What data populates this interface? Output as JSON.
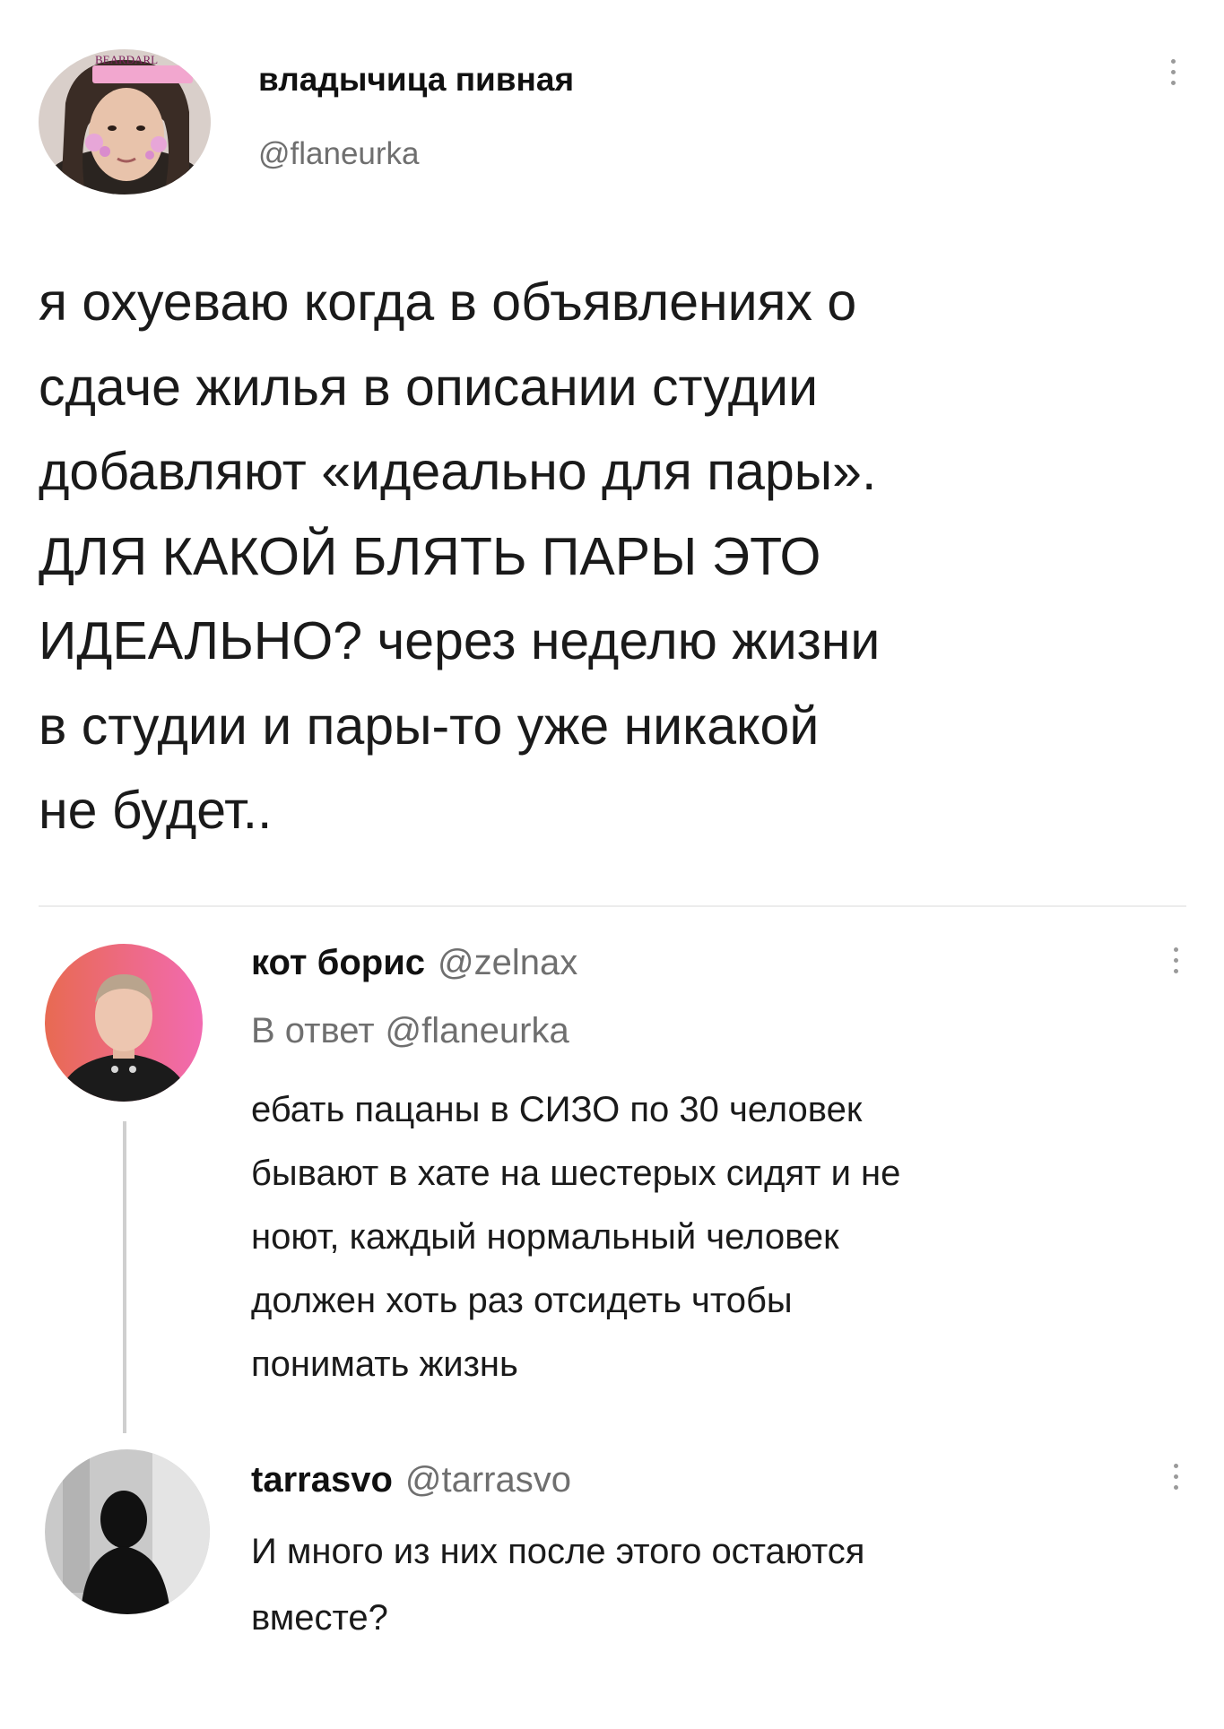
{
  "main_tweet": {
    "author_name": "владычица пивная",
    "author_handle": "@flaneurka",
    "avatar_badge_text": "BEARDARL",
    "text_lines": [
      "я охуеваю когда в объявлениях о",
      "сдаче жилья в описании студии",
      "добавляют «идеально для пары».",
      "ДЛЯ КАКОЙ БЛЯТЬ ПАРЫ ЭТО",
      "ИДЕАЛЬНО? через неделю жизни",
      "в студии и пары-то уже никакой",
      "не будет.."
    ]
  },
  "reply_1": {
    "author_name": "кот борис",
    "author_handle": "@zelnax",
    "reply_to_prefix": "В ответ",
    "reply_to_handle": "@flaneurka",
    "text_lines": [
      "ебать пацаны в СИЗО по 30 человек",
      "бывают в хате на шестерых сидят и не",
      "ноют, каждый нормальный человек",
      "должен хоть раз отсидеть чтобы",
      "понимать жизнь"
    ]
  },
  "reply_2": {
    "author_name": "tarrasvo",
    "author_handle": "@tarrasvo",
    "text_lines": [
      "И много из них после этого остаются",
      "вместе?"
    ]
  },
  "colors": {
    "text": "#1a1a1a",
    "handle": "#6f6f6f",
    "divider": "#ececec",
    "thread_line": "#cfcfcf"
  }
}
